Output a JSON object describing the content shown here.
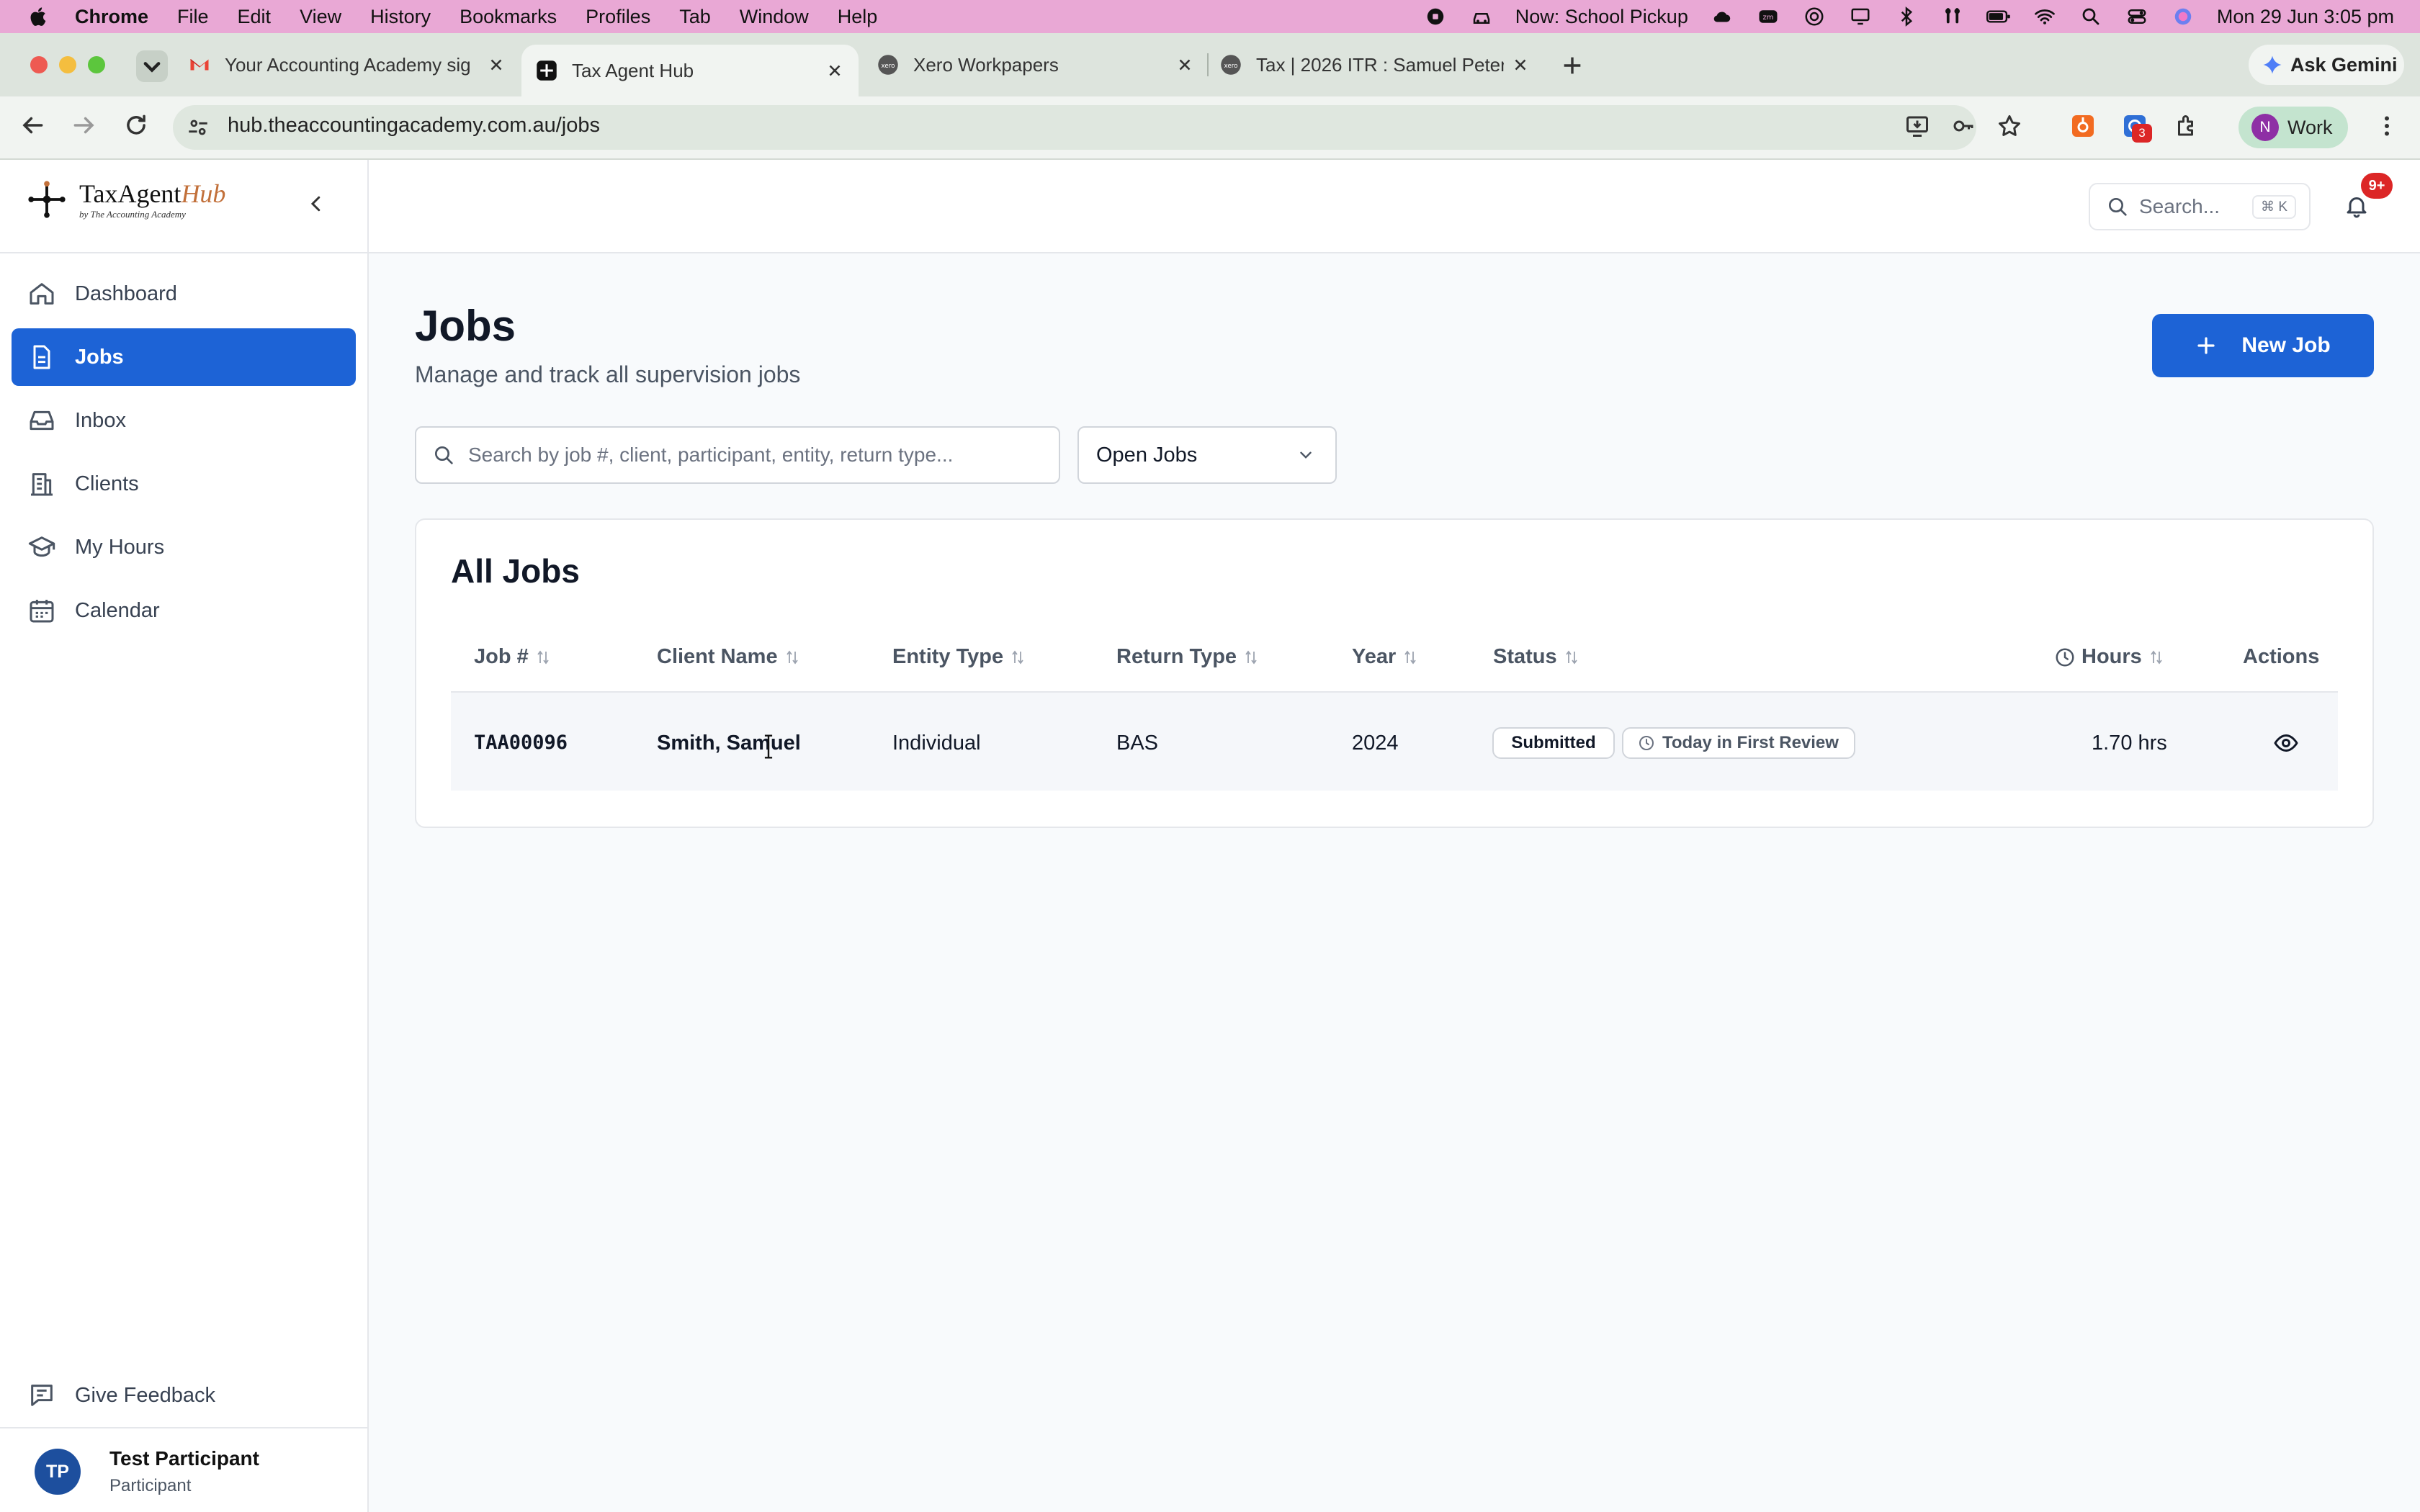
{
  "menubar": {
    "app": "Chrome",
    "items": [
      "File",
      "Edit",
      "View",
      "History",
      "Bookmarks",
      "Profiles",
      "Tab",
      "Window",
      "Help"
    ],
    "now_playing": "Now: School Pickup",
    "clock": "Mon 29 Jun  3:05 pm"
  },
  "browser": {
    "tabs": [
      {
        "title": "Your Accounting Academy sig",
        "icon": "gmail-icon",
        "active": false
      },
      {
        "title": "Tax Agent Hub",
        "icon": "taxagenthub-icon",
        "active": true
      },
      {
        "title": "Xero Workpapers",
        "icon": "xero-icon",
        "active": false
      },
      {
        "title": "Tax | 2026 ITR : Samuel Peter",
        "icon": "xero-icon",
        "active": false
      }
    ],
    "ask_gemini": "Ask Gemini",
    "url": "hub.theaccountingacademy.com.au/jobs",
    "extension_badge": "3",
    "profile_initial": "N",
    "profile_label": "Work"
  },
  "brand": {
    "name_plain": "TaxAgent",
    "name_italic": "Hub",
    "tagline": "by The Accounting Academy"
  },
  "sidebar": {
    "items": [
      {
        "label": "Dashboard",
        "icon": "home-icon"
      },
      {
        "label": "Jobs",
        "icon": "document-icon",
        "active": true
      },
      {
        "label": "Inbox",
        "icon": "inbox-icon"
      },
      {
        "label": "Clients",
        "icon": "building-icon"
      },
      {
        "label": "My Hours",
        "icon": "graduation-cap-icon"
      },
      {
        "label": "Calendar",
        "icon": "calendar-icon"
      }
    ],
    "feedback": "Give Feedback",
    "user": {
      "initials": "TP",
      "name": "Test Participant",
      "role": "Participant"
    }
  },
  "header": {
    "search_placeholder": "Search...",
    "search_shortcut": "⌘ K",
    "notification_badge": "9+"
  },
  "page": {
    "title": "Jobs",
    "subtitle": "Manage and track all supervision jobs",
    "new_job": "New Job",
    "search_placeholder": "Search by job #, client, participant, entity, return type...",
    "filter_value": "Open Jobs"
  },
  "table": {
    "title": "All Jobs",
    "columns": [
      "Job #",
      "Client Name",
      "Entity Type",
      "Return Type",
      "Year",
      "Status",
      "Hours",
      "Actions"
    ],
    "rows": [
      {
        "job": "TAA00096",
        "client": "Smith, Samuel",
        "entity": "Individual",
        "return_type": "BAS",
        "year": "2024",
        "status": "Submitted",
        "stage": "Today in First Review",
        "hours": "1.70 hrs"
      }
    ]
  },
  "colors": {
    "accent": "#1d63d6",
    "menubar": "#e9a8d5",
    "badge": "#dc2626",
    "brand_italic": "#c2703a"
  }
}
